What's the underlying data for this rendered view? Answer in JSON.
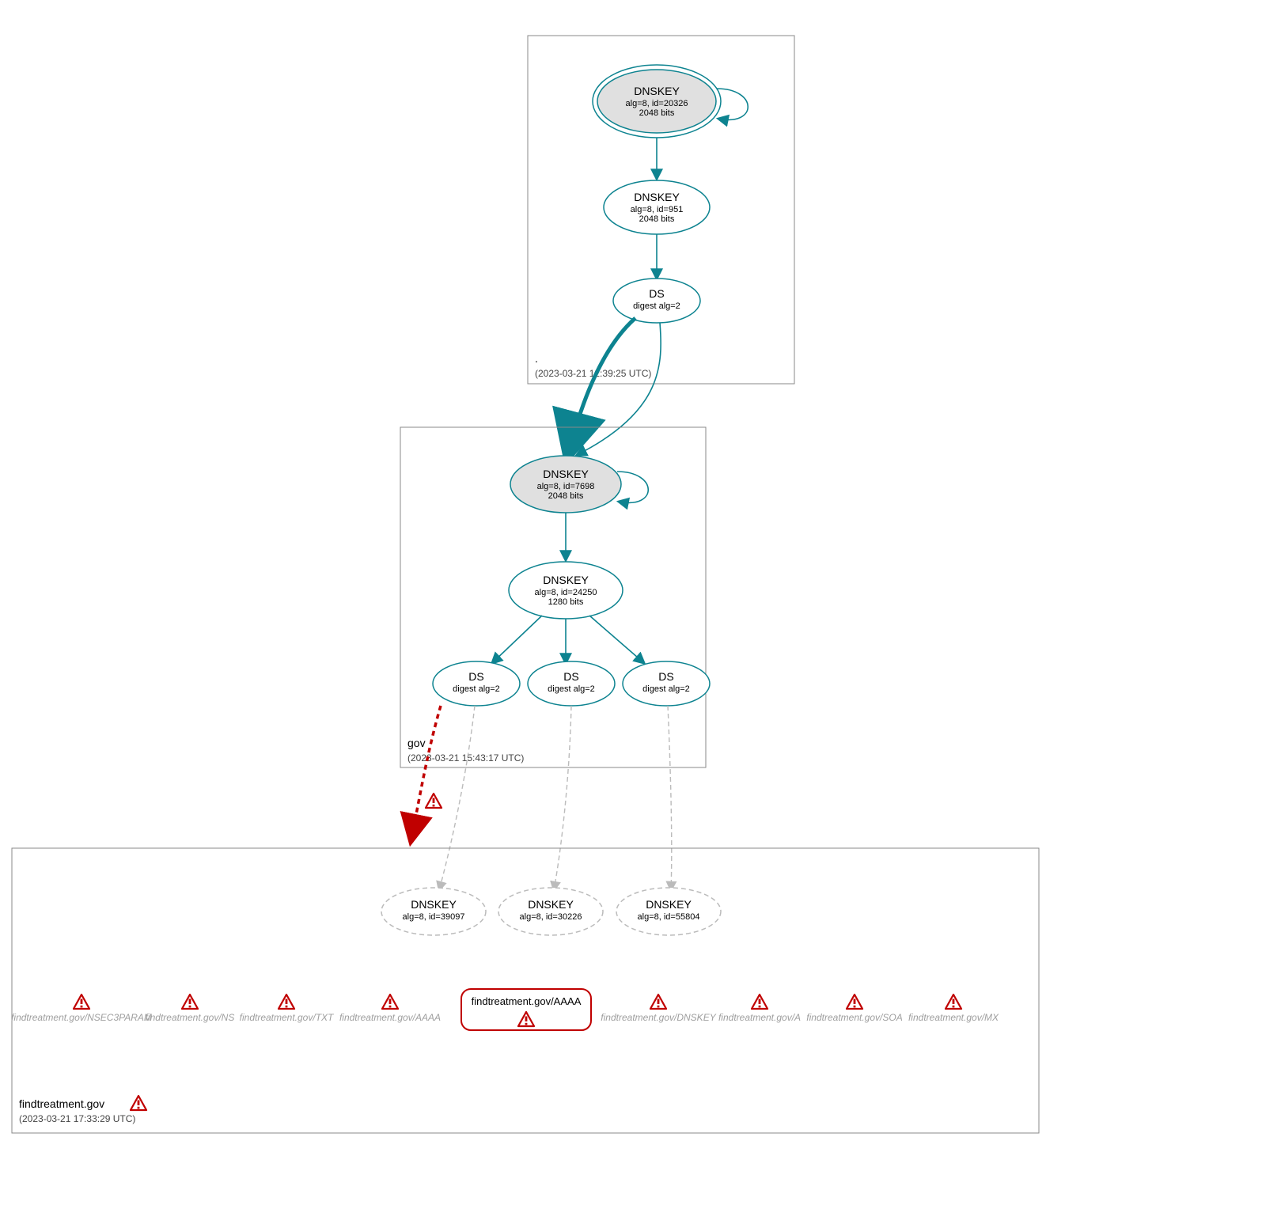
{
  "colors": {
    "teal": "#0d8390",
    "red": "#c00000",
    "grey": "#bbbbbb"
  },
  "zones": {
    "root": {
      "label": ".",
      "timestamp": "(2023-03-21 12:39:25 UTC)"
    },
    "gov": {
      "label": "gov",
      "timestamp": "(2023-03-21 15:43:17 UTC)"
    },
    "leaf": {
      "label": "findtreatment.gov",
      "timestamp": "(2023-03-21 17:33:29 UTC)"
    }
  },
  "nodes": {
    "root_ksk": {
      "title": "DNSKEY",
      "sub1": "alg=8, id=20326",
      "sub2": "2048 bits"
    },
    "root_zsk": {
      "title": "DNSKEY",
      "sub1": "alg=8, id=951",
      "sub2": "2048 bits"
    },
    "root_ds": {
      "title": "DS",
      "sub1": "digest alg=2"
    },
    "gov_ksk": {
      "title": "DNSKEY",
      "sub1": "alg=8, id=7698",
      "sub2": "2048 bits"
    },
    "gov_zsk": {
      "title": "DNSKEY",
      "sub1": "alg=8, id=24250",
      "sub2": "1280 bits"
    },
    "gov_ds1": {
      "title": "DS",
      "sub1": "digest alg=2"
    },
    "gov_ds2": {
      "title": "DS",
      "sub1": "digest alg=2"
    },
    "gov_ds3": {
      "title": "DS",
      "sub1": "digest alg=2"
    },
    "leaf_k1": {
      "title": "DNSKEY",
      "sub1": "alg=8, id=39097"
    },
    "leaf_k2": {
      "title": "DNSKEY",
      "sub1": "alg=8, id=30226"
    },
    "leaf_k3": {
      "title": "DNSKEY",
      "sub1": "alg=8, id=55804"
    }
  },
  "rrsets": {
    "nsec3param": "findtreatment.gov/NSEC3PARAM",
    "ns": "findtreatment.gov/NS",
    "txt": "findtreatment.gov/TXT",
    "aaaa_grey": "findtreatment.gov/AAAA",
    "aaaa_main": "findtreatment.gov/AAAA",
    "dnskey": "findtreatment.gov/DNSKEY",
    "a": "findtreatment.gov/A",
    "soa": "findtreatment.gov/SOA",
    "mx": "findtreatment.gov/MX"
  }
}
